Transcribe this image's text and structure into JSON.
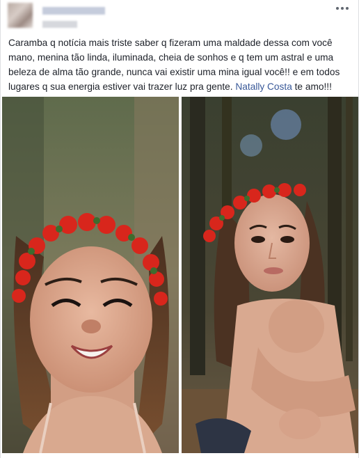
{
  "post": {
    "text_before_mention": "Caramba q notícia mais triste saber q fizeram uma maldade dessa com você mano, menina tão linda, iluminada, cheia de sonhos e q tem um astral e uma beleza de alma tão grande, nunca vai existir uma mina igual você!! e em todos lugares q sua energia estiver vai trazer luz pra gente.",
    "mention": "Natally Costa",
    "text_after_mention": "te amo!!!",
    "mention_color": "#385898",
    "more_icon": "more-horizontal-icon"
  },
  "photos": [
    {
      "name": "photo-left",
      "alt": "photo"
    },
    {
      "name": "photo-right",
      "alt": "photo"
    }
  ]
}
